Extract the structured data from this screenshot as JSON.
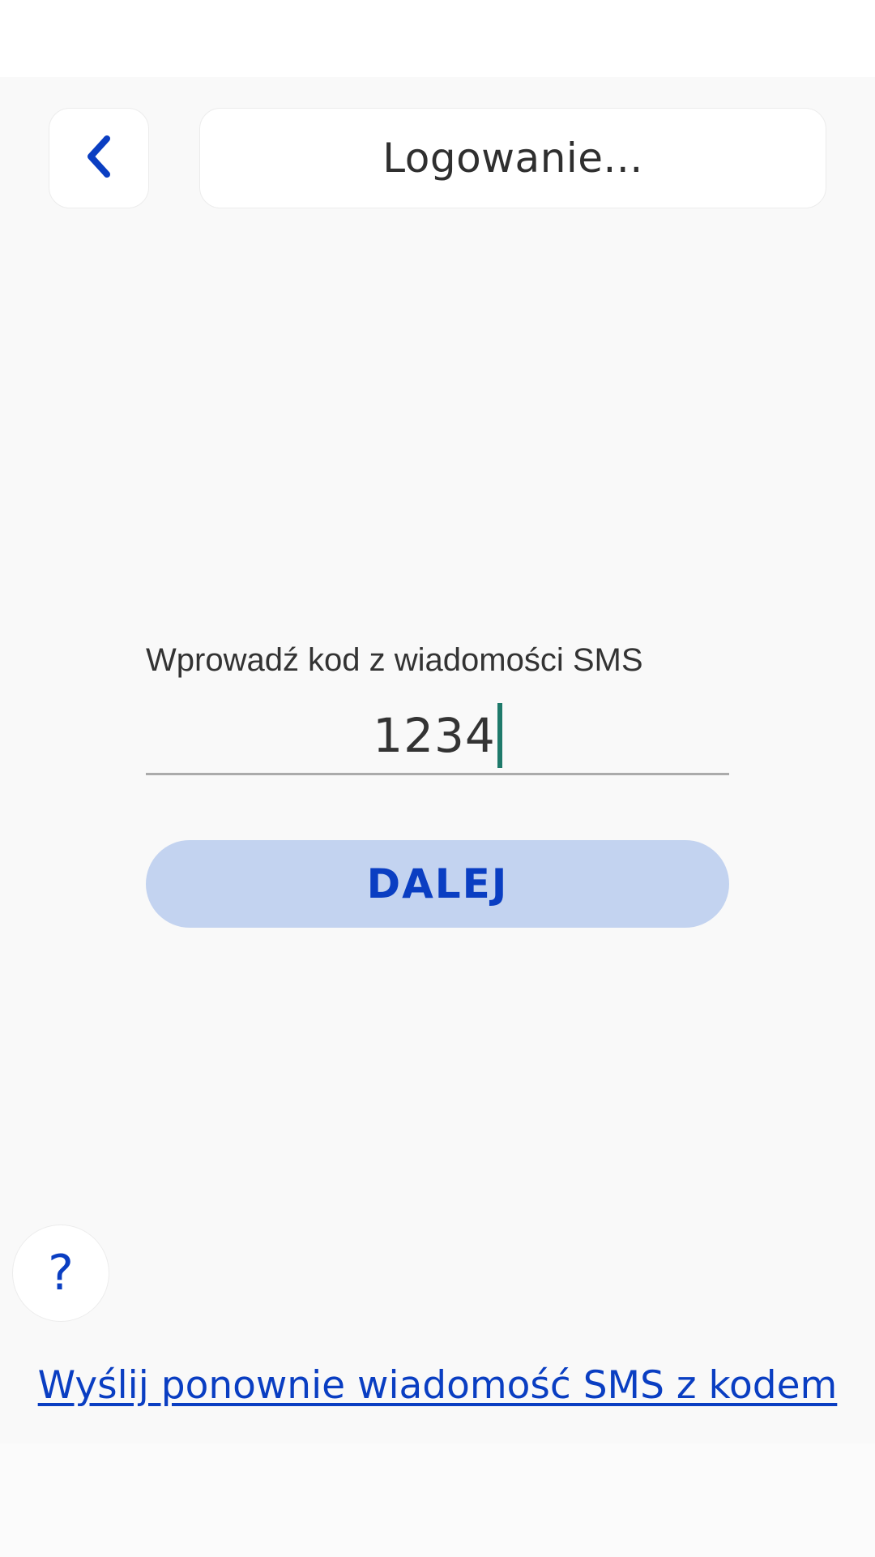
{
  "header": {
    "title": "Logowanie..."
  },
  "form": {
    "label": "Wprowadź kod z wiadomości SMS",
    "code_value": "1234"
  },
  "actions": {
    "next_label": "DALEJ",
    "help_glyph": "?",
    "resend_link": "Wyślij ponownie wiadomość SMS z kodem"
  },
  "icons": {
    "back": "chevron-left-icon",
    "help": "question-mark-icon"
  },
  "colors": {
    "accent": "#0a3ec2",
    "button_bg": "#c3d3f0",
    "caret": "#1f7a6b",
    "app_bg": "#f9f9f9"
  }
}
